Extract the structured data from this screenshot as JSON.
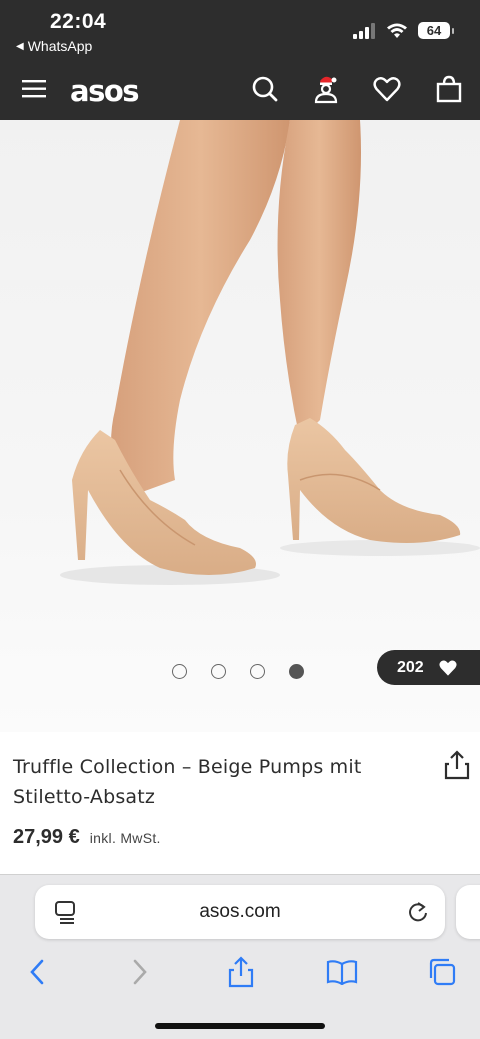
{
  "status": {
    "time": "22:04",
    "back_app": "WhatsApp",
    "battery": "64"
  },
  "header": {
    "logo": "asos",
    "icons": [
      "menu-icon",
      "search-icon",
      "account-icon",
      "heart-icon",
      "bag-icon"
    ]
  },
  "gallery": {
    "image_count": 4,
    "active_index": 3,
    "likes": "202"
  },
  "product": {
    "title": "Truffle Collection – Beige Pumps mit Stiletto-Absatz",
    "price": "27,99 €",
    "tax_note": "inkl. MwSt."
  },
  "browser": {
    "url": "asos.com",
    "toolbar": [
      "back-icon",
      "forward-icon",
      "share-icon",
      "bookmarks-icon",
      "tabs-icon"
    ]
  },
  "colors": {
    "header_bg": "#2d2d2d",
    "accent_blue": "#2f7cf6",
    "shoe": "#e2b995"
  }
}
